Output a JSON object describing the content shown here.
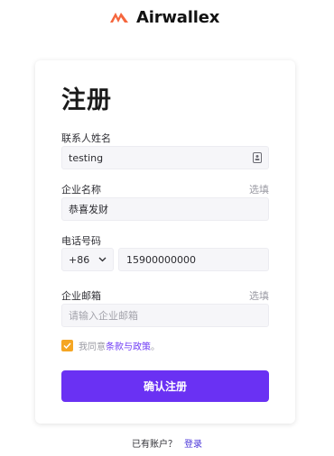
{
  "brand": {
    "name": "Airwallex",
    "accent": "#f5663d"
  },
  "form": {
    "title": "注册",
    "contact_name_label": "联系人姓名",
    "contact_name_value": "testing",
    "company_label": "企业名称",
    "company_optional": "选填",
    "company_value": "恭喜发财",
    "phone_label": "电话号码",
    "country_code": "+86",
    "phone_value": "15900000000",
    "email_label": "企业邮箱",
    "email_optional": "选填",
    "email_placeholder": "请输入企业邮箱",
    "agree_prefix": "我同意",
    "agree_link": "条款与政策",
    "agree_suffix": "。",
    "submit_label": "确认注册"
  },
  "footer": {
    "question": "已有账户？",
    "login_link": "登录"
  },
  "colors": {
    "primary": "#6a31f3",
    "checkbox": "#f5a623",
    "link": "#4a36d9"
  }
}
